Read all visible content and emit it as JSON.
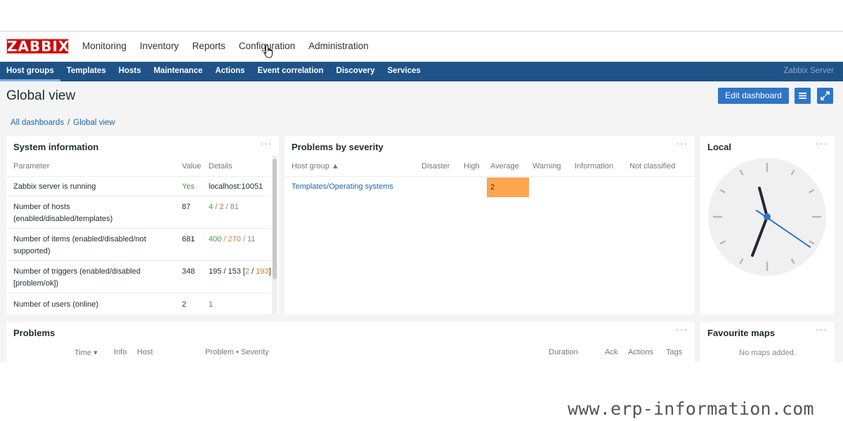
{
  "brand": {
    "logo_text": "ZABBIX",
    "logo_color": "#d40000"
  },
  "topmenu": [
    "Monitoring",
    "Inventory",
    "Reports",
    "Configuration",
    "Administration"
  ],
  "subnav": {
    "items": [
      "Host groups",
      "Templates",
      "Hosts",
      "Maintenance",
      "Actions",
      "Event correlation",
      "Discovery",
      "Services"
    ],
    "active": "Host groups",
    "server_name": "Zabbix Server",
    "background": "#1f5387"
  },
  "page": {
    "title": "Global view",
    "edit_button": "Edit dashboard"
  },
  "breadcrumb": {
    "root": "All dashboards",
    "separator": "/",
    "current": "Global view"
  },
  "system_information": {
    "title": "System information",
    "menu": "···",
    "columns": [
      "Parameter",
      "Value",
      "Details"
    ],
    "rows": [
      {
        "parameter": "Zabbix server is running",
        "value": "Yes",
        "details": "localhost:10051"
      },
      {
        "parameter": "Number of hosts (enabled/disabled/templates)",
        "value": "87",
        "details_parts": [
          "4",
          "/",
          "2",
          "/",
          "81"
        ]
      },
      {
        "parameter": "Number of items (enabled/disabled/not supported)",
        "value": "681",
        "details_parts": [
          "400",
          "/",
          "270",
          "/",
          "11"
        ]
      },
      {
        "parameter": "Number of triggers (enabled/disabled [problem/ok])",
        "value": "348",
        "details_parts": [
          "195 / 153 [",
          "2",
          " / ",
          "193",
          "]"
        ]
      },
      {
        "parameter": "Number of users (online)",
        "value": "2",
        "details": "1"
      }
    ]
  },
  "problems_by_severity": {
    "title": "Problems by severity",
    "menu": "···",
    "columns": [
      "Host group ▲",
      "Disaster",
      "High",
      "Average",
      "Warning",
      "Information",
      "Not classified"
    ],
    "rows": [
      {
        "host_group": "Templates/Operating systems",
        "average": "2"
      }
    ],
    "average_color": "#ffa64e"
  },
  "local_clock": {
    "title": "Local",
    "menu": "···"
  },
  "problems": {
    "title": "Problems",
    "menu": "···",
    "columns": [
      "Time ▾",
      "Info",
      "Host",
      "Problem • Severity",
      "Duration",
      "Ack",
      "Actions",
      "Tags"
    ]
  },
  "favourite_maps": {
    "title": "Favourite maps",
    "menu": "···",
    "empty_text": "No maps added."
  },
  "watermark": "www.erp-information.com"
}
